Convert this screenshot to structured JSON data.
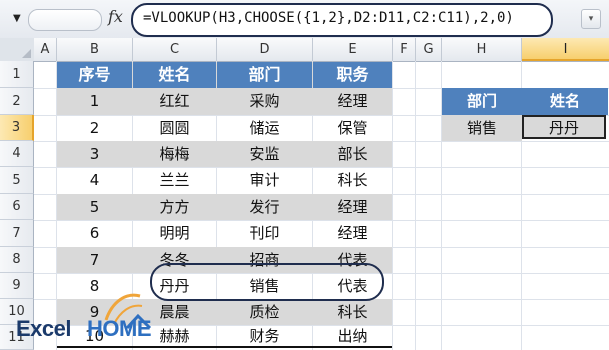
{
  "formula_bar": {
    "fx_label": "fx",
    "formula": "=VLOOKUP(H3,CHOOSE({1,2},D2:D11,C2:C11),2,0)"
  },
  "columns": [
    "A",
    "B",
    "C",
    "D",
    "E",
    "F",
    "G",
    "H",
    "I"
  ],
  "active_column": "I",
  "rows": [
    "1",
    "2",
    "3",
    "4",
    "5",
    "6",
    "7",
    "8",
    "9",
    "10",
    "11"
  ],
  "active_row": "3",
  "main_table": {
    "headers": [
      "序号",
      "姓名",
      "部门",
      "职务"
    ],
    "rows": [
      [
        "1",
        "红红",
        "采购",
        "经理"
      ],
      [
        "2",
        "圆圆",
        "储运",
        "保管"
      ],
      [
        "3",
        "梅梅",
        "安监",
        "部长"
      ],
      [
        "4",
        "兰兰",
        "审计",
        "科长"
      ],
      [
        "5",
        "方方",
        "发行",
        "经理"
      ],
      [
        "6",
        "明明",
        "刊印",
        "经理"
      ],
      [
        "7",
        "冬冬",
        "招商",
        "代表"
      ],
      [
        "8",
        "丹丹",
        "销售",
        "代表"
      ],
      [
        "9",
        "晨晨",
        "质检",
        "科长"
      ],
      [
        "10",
        "赫赫",
        "财务",
        "出纳"
      ]
    ]
  },
  "lookup_table": {
    "headers": [
      "部门",
      "姓名"
    ],
    "values": [
      "销售",
      "丹丹"
    ]
  },
  "logo": {
    "part1": "Excel",
    "part2": "HOME"
  },
  "colors": {
    "header_blue": "#4f81bd",
    "band_gray": "#d9d9d9",
    "highlight": "#1f2d4e"
  }
}
